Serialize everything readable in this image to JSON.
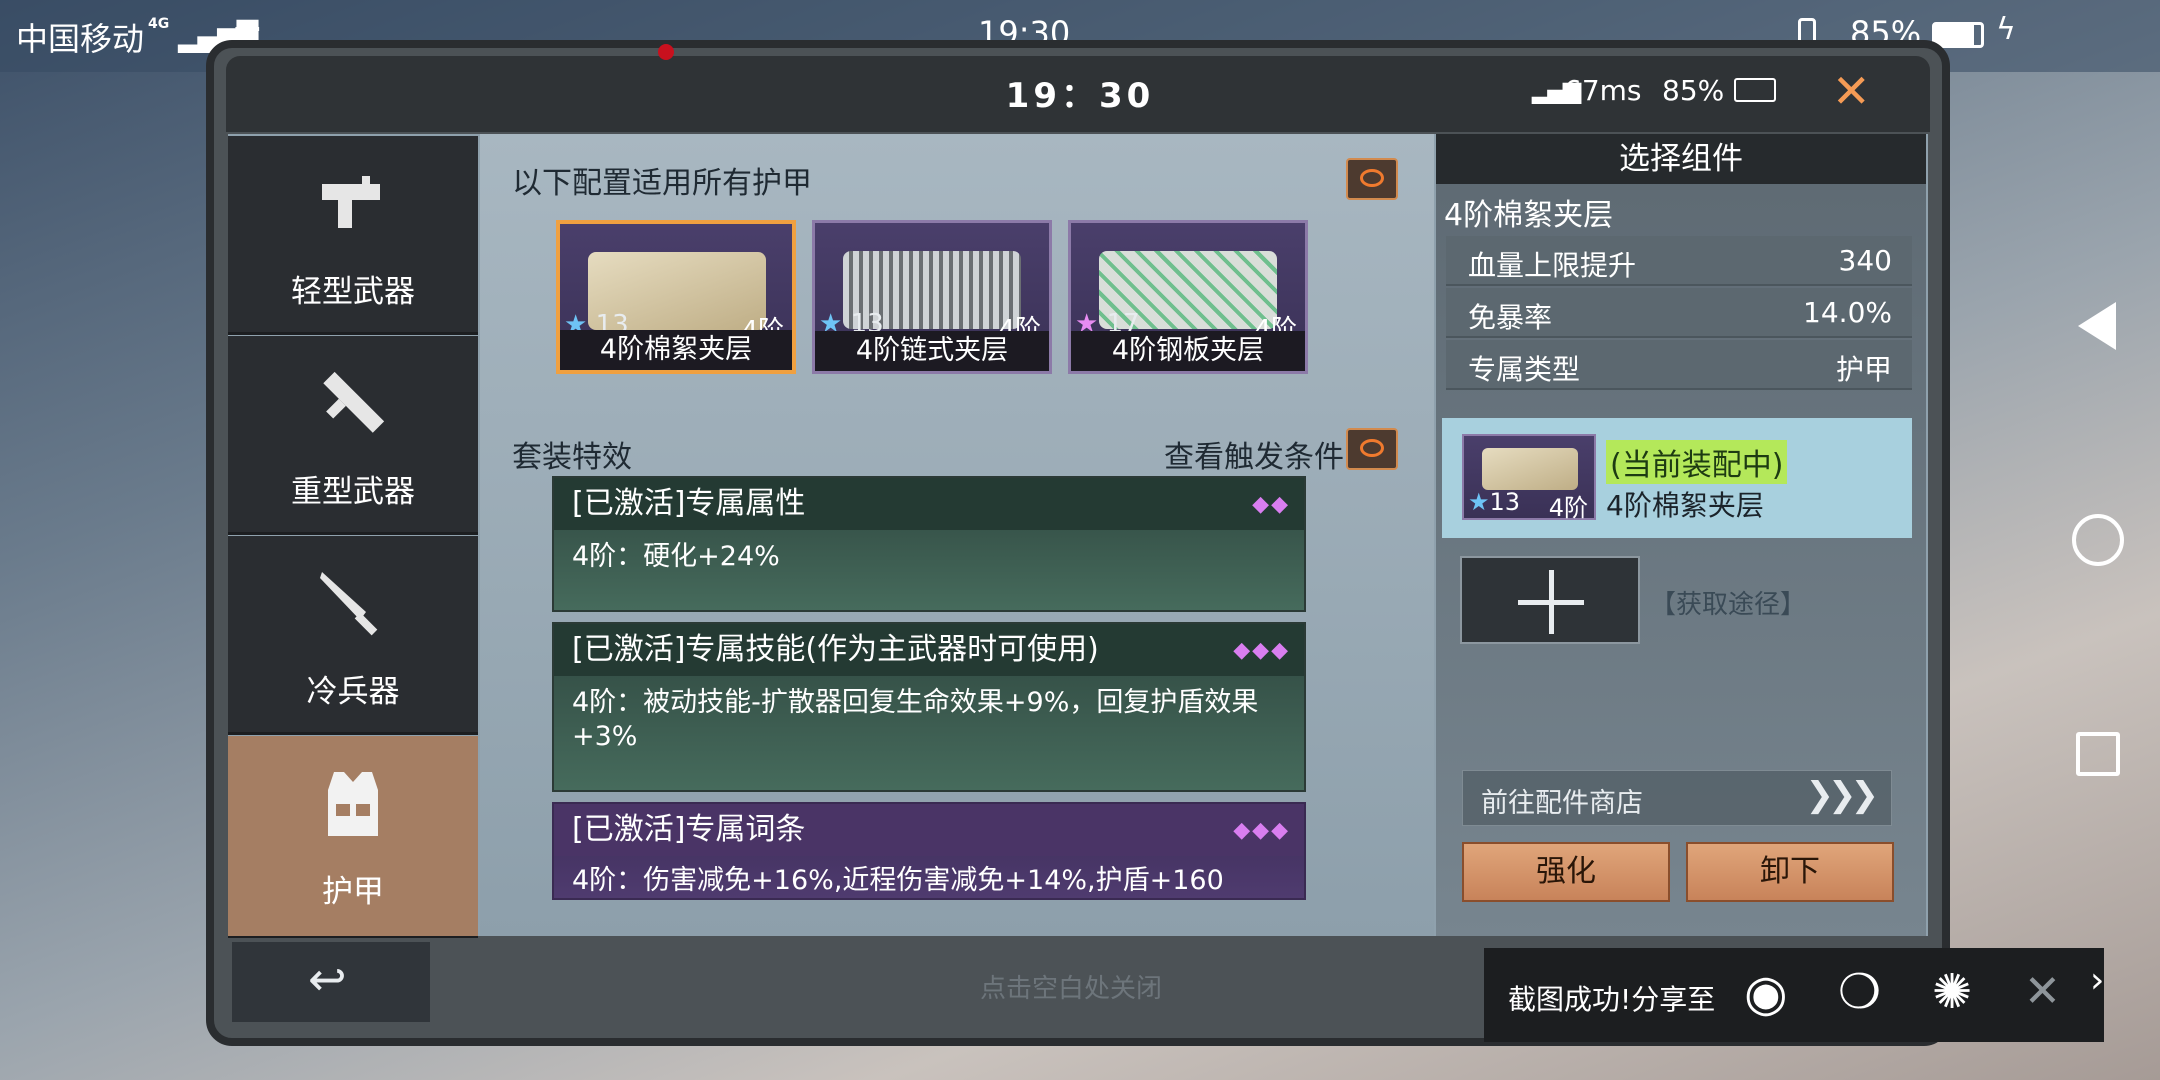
{
  "status_bar": {
    "carrier": "中国移动",
    "network": "4G",
    "more": "···",
    "time": "19:30",
    "battery": "85%"
  },
  "game_header": {
    "time": "19：30",
    "ping": "67ms",
    "battery": "85%"
  },
  "sidebar": {
    "items": [
      {
        "label": "轻型武器",
        "icon": "smg-icon"
      },
      {
        "label": "重型武器",
        "icon": "launcher-icon"
      },
      {
        "label": "冷兵器",
        "icon": "knife-icon"
      },
      {
        "label": "护甲",
        "icon": "vest-icon"
      }
    ],
    "back_label": "点击空白处关闭"
  },
  "main": {
    "config_title": "以下配置适用所有护甲",
    "items": [
      {
        "stars": "13",
        "star_color": "#6ec3f5",
        "tier": "4阶",
        "name": "4阶棉絮夹层"
      },
      {
        "stars": "13",
        "star_color": "#6ec3f5",
        "tier": "4阶",
        "name": "4阶链式夹层"
      },
      {
        "stars": "17",
        "star_color": "#e88cf2",
        "tier": "4阶",
        "name": "4阶钢板夹层"
      }
    ],
    "set_title": "套装特效",
    "trigger_label": "查看触发条件",
    "effects": [
      {
        "title": "[已激活]专属属性",
        "body": "4阶：硬化+24%"
      },
      {
        "title": "[已激活]专属技能(作为主武器时可使用)",
        "body": "4阶：被动技能-扩散器回复生命效果+9%，回复护盾效果+3%"
      },
      {
        "title": "[已激活]专属词条",
        "body": "4阶：伤害减免+16%,近程伤害减免+14%,护盾+160"
      }
    ]
  },
  "right_panel": {
    "title": "选择组件",
    "component_name": "4阶棉絮夹层",
    "stats": [
      {
        "key": "血量上限提升",
        "value": "340"
      },
      {
        "key": "免暴率",
        "value": "14.0%"
      },
      {
        "key": "专属类型",
        "value": "护甲"
      }
    ],
    "equipped_tag": "(当前装配中)",
    "equipped_stars": "13",
    "equipped_tier": "4阶",
    "equipped_name": "4阶棉絮夹层",
    "obtain_label": "【获取途径】",
    "shop_label": "前往配件商店",
    "enhance_label": "强化",
    "unequip_label": "卸下"
  },
  "toast": {
    "label": "截图成功!分享至"
  }
}
